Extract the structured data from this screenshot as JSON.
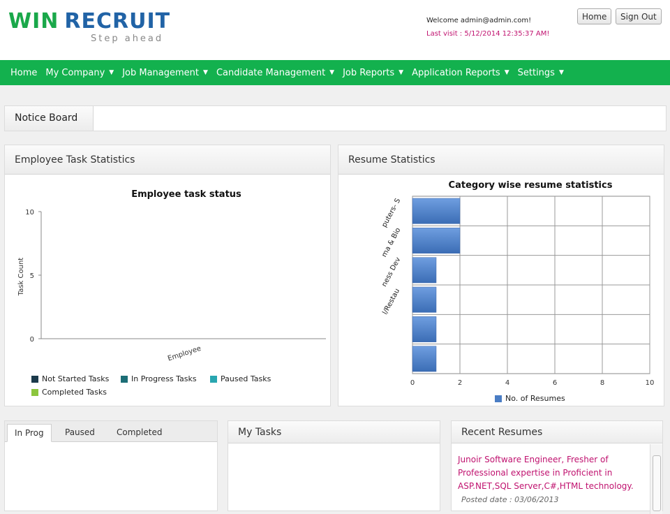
{
  "header": {
    "logo_win": "WIN",
    "logo_recruit": "RECRUIT",
    "logo_tagline": "Step ahead",
    "welcome": "Welcome admin@admin.com!",
    "last_visit": "Last visit : 5/12/2014 12:35:37 AM!",
    "home_label": "Home",
    "signout_label": "Sign Out"
  },
  "nav": {
    "items": [
      {
        "label": "Home",
        "caret": false
      },
      {
        "label": "My Company",
        "caret": true
      },
      {
        "label": "Job Management",
        "caret": true
      },
      {
        "label": "Candidate Management",
        "caret": true
      },
      {
        "label": "Job Reports",
        "caret": true
      },
      {
        "label": "Application Reports",
        "caret": true
      },
      {
        "label": "Settings",
        "caret": true
      }
    ]
  },
  "notice_board": {
    "title": "Notice Board"
  },
  "employee_panel": {
    "title": "Employee Task Statistics"
  },
  "resume_panel": {
    "title": "Resume Statistics"
  },
  "tasks_tabs": {
    "tabs": [
      "In Prog",
      "Paused",
      "Completed"
    ]
  },
  "my_tasks": {
    "title": "My Tasks"
  },
  "recent_resumes": {
    "title": "Recent Resumes",
    "item_title": "Junoir Software Engineer, Fresher of Professional expertise in Proficient in ASP.NET,SQL Server,C#,HTML technology.",
    "item_date": "Posted date : 03/06/2013"
  },
  "chart_data": [
    {
      "type": "bar",
      "title": "Employee task status",
      "ylabel": "Task Count",
      "categories": [
        "Employee"
      ],
      "ylim": [
        0,
        10
      ],
      "yticks": [
        0,
        5,
        10
      ],
      "series": [
        {
          "name": "Not Started Tasks",
          "color": "#1b3a4b",
          "values": [
            0
          ]
        },
        {
          "name": "In Progress Tasks",
          "color": "#1d6e76",
          "values": [
            0
          ]
        },
        {
          "name": "Paused Tasks",
          "color": "#29a6b0",
          "values": [
            0
          ]
        },
        {
          "name": "Completed Tasks",
          "color": "#8cc63e",
          "values": [
            0
          ]
        }
      ],
      "legend": "bottom"
    },
    {
      "type": "bar",
      "orientation": "horizontal",
      "title": "Category wise resume statistics",
      "category_labels": [
        "puters- S",
        "ma & Bio",
        "ness Dev",
        "l/Restau"
      ],
      "xlim": [
        0,
        10
      ],
      "xticks": [
        0,
        2,
        4,
        6,
        8,
        10
      ],
      "series": [
        {
          "name": "No. of Resumes",
          "color": "#4a7dc4",
          "values": [
            2,
            2,
            1,
            1,
            1,
            1
          ]
        }
      ],
      "grid": true,
      "legend": "bottom"
    }
  ]
}
